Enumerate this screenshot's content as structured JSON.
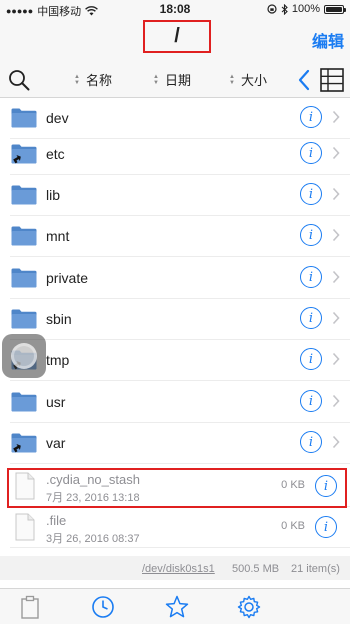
{
  "status_bar": {
    "carrier": "中国移动",
    "time": "18:08",
    "battery_text": "100%",
    "battery_level": 1.0
  },
  "nav": {
    "title": "/",
    "edit_label": "编辑"
  },
  "toolbar": {
    "sort_name": "名称",
    "sort_date": "日期",
    "sort_size": "大小"
  },
  "items": [
    {
      "name": "dev",
      "kind": "folder",
      "alias": false
    },
    {
      "name": "etc",
      "kind": "folder",
      "alias": true
    },
    {
      "name": "lib",
      "kind": "folder",
      "alias": false
    },
    {
      "name": "mnt",
      "kind": "folder",
      "alias": false
    },
    {
      "name": "private",
      "kind": "folder",
      "alias": false
    },
    {
      "name": "sbin",
      "kind": "folder",
      "alias": false
    },
    {
      "name": "tmp",
      "kind": "folder",
      "alias": true
    },
    {
      "name": "usr",
      "kind": "folder",
      "alias": false
    },
    {
      "name": "var",
      "kind": "folder",
      "alias": true
    },
    {
      "name": ".cydia_no_stash",
      "kind": "file",
      "date": "7月 23, 2016 13:18",
      "size": "0 KB"
    },
    {
      "name": ".file",
      "kind": "file",
      "date": "3月 26, 2016 08:37",
      "size": "0 KB"
    }
  ],
  "footer": {
    "path": "/dev/disk0s1s1",
    "disk": "500.5 MB",
    "count": "21 item(s)"
  },
  "colors": {
    "accent": "#1a7cf2",
    "folder": "#4f86c9",
    "highlight": "#e02020"
  }
}
